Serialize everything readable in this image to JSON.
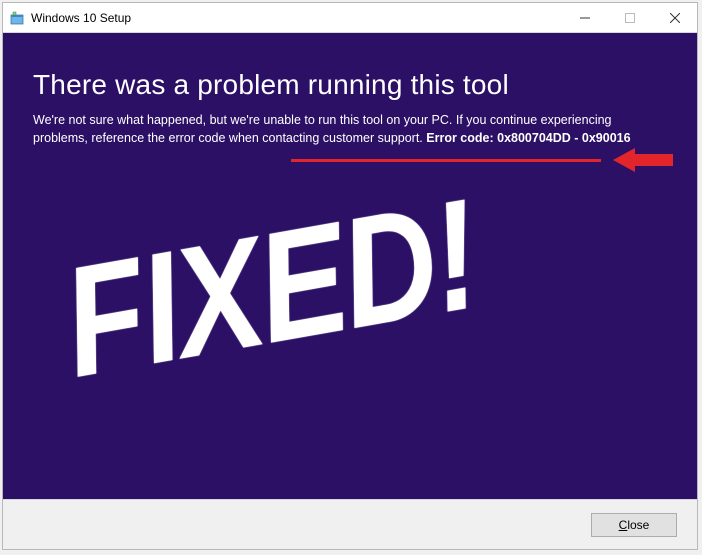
{
  "window": {
    "title": "Windows 10 Setup"
  },
  "content": {
    "heading": "There was a problem running this tool",
    "description_prefix": "We're not sure what happened, but we're unable to run this tool on your PC. If you continue experiencing problems, reference the error code when contacting customer support. ",
    "error_label": "Error code: 0x800704DD - 0x90016"
  },
  "annotations": {
    "stamp": "FIXED!"
  },
  "footer": {
    "close_label": "lose"
  }
}
